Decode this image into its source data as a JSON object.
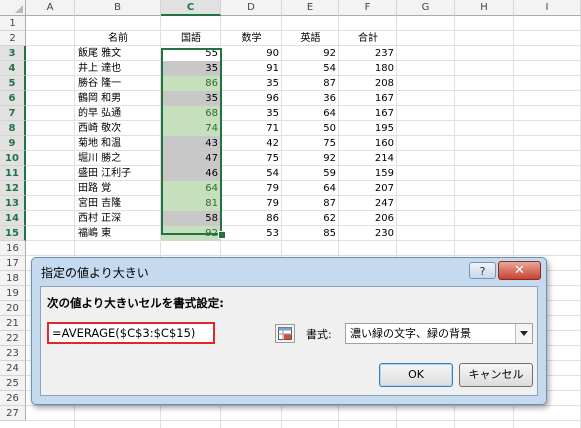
{
  "columns": [
    "A",
    "B",
    "C",
    "D",
    "E",
    "F",
    "G",
    "H",
    "I"
  ],
  "selected_column": "C",
  "rows": [
    "1",
    "2",
    "3",
    "4",
    "5",
    "6",
    "7",
    "8",
    "9",
    "10",
    "11",
    "12",
    "13",
    "14",
    "15",
    "16",
    "17",
    "18",
    "19",
    "20",
    "21",
    "22",
    "23",
    "24",
    "25",
    "26",
    "27"
  ],
  "headers": {
    "name": "名前",
    "kokugo": "国語",
    "sugaku": "数学",
    "eigo": "英語",
    "total": "合計"
  },
  "students": [
    {
      "name": "飯尾 雅文",
      "kokugo": "55",
      "sugaku": "90",
      "eigo": "92",
      "total": "237",
      "highlight": false
    },
    {
      "name": "井上 達也",
      "kokugo": "35",
      "sugaku": "91",
      "eigo": "54",
      "total": "180",
      "highlight": false
    },
    {
      "name": "勝谷 隆一",
      "kokugo": "86",
      "sugaku": "35",
      "eigo": "87",
      "total": "208",
      "highlight": true
    },
    {
      "name": "鶴岡 和男",
      "kokugo": "35",
      "sugaku": "96",
      "eigo": "36",
      "total": "167",
      "highlight": false
    },
    {
      "name": "的早 弘通",
      "kokugo": "68",
      "sugaku": "35",
      "eigo": "64",
      "total": "167",
      "highlight": true
    },
    {
      "name": "西崎 敬次",
      "kokugo": "74",
      "sugaku": "71",
      "eigo": "50",
      "total": "195",
      "highlight": true
    },
    {
      "name": "菊地 和温",
      "kokugo": "43",
      "sugaku": "42",
      "eigo": "75",
      "total": "160",
      "highlight": false
    },
    {
      "name": "堀川 勝之",
      "kokugo": "47",
      "sugaku": "75",
      "eigo": "92",
      "total": "214",
      "highlight": false
    },
    {
      "name": "盛田 江利子",
      "kokugo": "46",
      "sugaku": "54",
      "eigo": "59",
      "total": "159",
      "highlight": false
    },
    {
      "name": "田路 覚",
      "kokugo": "64",
      "sugaku": "79",
      "eigo": "64",
      "total": "207",
      "highlight": true
    },
    {
      "name": "宮田 吉隆",
      "kokugo": "81",
      "sugaku": "79",
      "eigo": "87",
      "total": "247",
      "highlight": true
    },
    {
      "name": "西村 正深",
      "kokugo": "58",
      "sugaku": "86",
      "eigo": "62",
      "total": "206",
      "highlight": false
    },
    {
      "name": "福嶋 東",
      "kokugo": "92",
      "sugaku": "53",
      "eigo": "85",
      "total": "230",
      "highlight": true
    }
  ],
  "dialog": {
    "title": "指定の値より大きい",
    "help": "?",
    "close": "✕",
    "heading": "次の値より大きいセルを書式設定:",
    "formula": "=AVERAGE($C$3:$C$15)",
    "format_label": "書式:",
    "format_value": "濃い緑の文字、緑の背景",
    "ok": "OK",
    "cancel": "キャンセル"
  },
  "colors": {
    "highlight_fill": "#c6dfbd",
    "highlight_text": "#2b6e2d",
    "selection": "#217346",
    "formula_border": "#e2262a"
  }
}
